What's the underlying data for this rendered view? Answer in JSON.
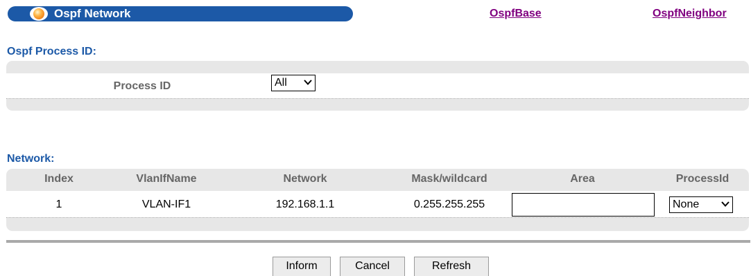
{
  "header": {
    "title": "Ospf Network",
    "links": [
      "OspfBase",
      "OspfNeighbor"
    ]
  },
  "process_section": {
    "title": "Ospf Process ID:",
    "label": "Process ID",
    "selected": "All"
  },
  "network_section": {
    "title": "Network:",
    "columns": [
      "Index",
      "VlanIfName",
      "Network",
      "Mask/wildcard",
      "Area",
      "ProcessId"
    ],
    "rows": [
      {
        "index": "1",
        "vlan_if_name": "VLAN-IF1",
        "network": "192.168.1.1",
        "mask": "0.255.255.255",
        "area": "",
        "process_id": "None"
      }
    ]
  },
  "buttons": {
    "inform": "Inform",
    "cancel": "Cancel",
    "refresh": "Refresh"
  },
  "colors": {
    "header_bar": "#1c59a7",
    "section_title": "#1c59a7",
    "link": "#800080",
    "panel": "#e7e7e7"
  }
}
